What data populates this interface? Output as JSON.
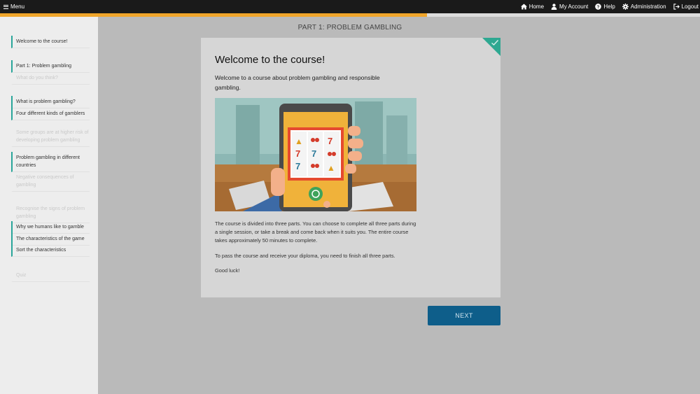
{
  "topbar": {
    "menu_label": "Menu",
    "nav": [
      {
        "label": "Home",
        "icon": "home-icon"
      },
      {
        "label": "My Account",
        "icon": "user-icon"
      },
      {
        "label": "Help",
        "icon": "help-icon"
      },
      {
        "label": "Administration",
        "icon": "gear-icon"
      },
      {
        "label": "Logout",
        "icon": "logout-icon"
      }
    ]
  },
  "progress": {
    "fraction": 0.61,
    "color": "#f0a62b"
  },
  "sidebar": {
    "items": [
      {
        "label": "Welcome to the course!",
        "state": "done"
      },
      {
        "label": "Part 1: Problem gambling",
        "state": "done"
      },
      {
        "label": "What do you think?",
        "state": "locked"
      },
      {
        "label": "What is problem gambling?",
        "state": "done"
      },
      {
        "label": "Four different kinds of gamblers",
        "state": "done"
      },
      {
        "label": "Some groups are at higher risk of developing problem gambling",
        "state": "locked"
      },
      {
        "label": "Problem gambling in different countries",
        "state": "done"
      },
      {
        "label": "Negative consequences of gambling",
        "state": "locked"
      },
      {
        "label": "Recognise the signs of problem gambling",
        "state": "locked"
      },
      {
        "label": "Why we humans like to gamble",
        "state": "done"
      },
      {
        "label": "The characteristics of the game",
        "state": "done"
      },
      {
        "label": "Sort the characteristics",
        "state": "done"
      },
      {
        "label": "Quiz",
        "state": "locked"
      }
    ]
  },
  "main": {
    "part_title": "PART 1: PROBLEM GAMBLING",
    "card": {
      "title": "Welcome to the course!",
      "lead": "Welcome to a course about problem gambling and responsible gambling.",
      "paragraphs": [
        "The course is divided into three parts. You can choose to complete all three parts during a single session, or take a break and come back when it suits you. The entire course takes approximately 50 minutes to complete.",
        "To pass the course and receive your diploma, you need to finish all three parts.",
        "Good luck!"
      ]
    },
    "next_label": "NEXT"
  },
  "colors": {
    "accent": "#2aa59a",
    "check": "#2ea891",
    "button": "#0e5e8a",
    "topbar": "#1a1a1a"
  }
}
